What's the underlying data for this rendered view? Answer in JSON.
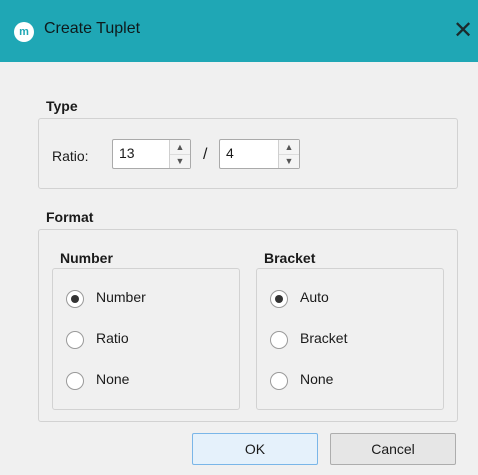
{
  "window": {
    "title": "Create Tuplet",
    "app_icon_glyph": "m",
    "close_glyph": "✕",
    "accent_color": "#1fa7b5"
  },
  "type_section": {
    "title": "Type",
    "ratio_label": "Ratio:",
    "ratio_separator": "/",
    "numerator": "13",
    "denominator": "4"
  },
  "format_section": {
    "title": "Format",
    "number_group": {
      "title": "Number",
      "options": [
        "Number",
        "Ratio",
        "None"
      ],
      "selected": "Number"
    },
    "bracket_group": {
      "title": "Bracket",
      "options": [
        "Auto",
        "Bracket",
        "None"
      ],
      "selected": "Auto"
    }
  },
  "buttons": {
    "ok": "OK",
    "cancel": "Cancel"
  }
}
